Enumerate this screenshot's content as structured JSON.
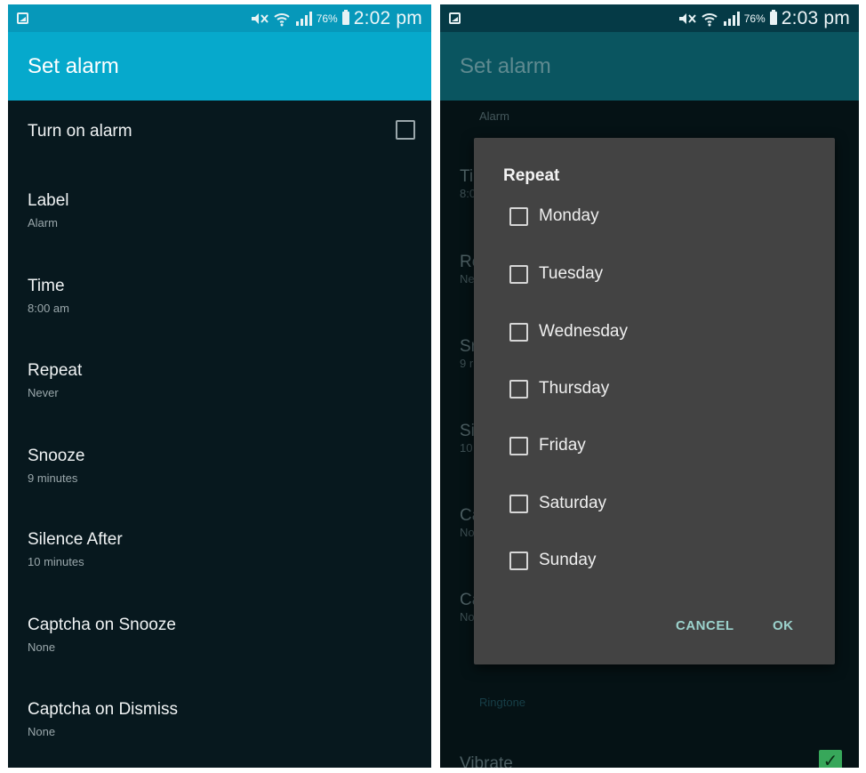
{
  "left": {
    "status": {
      "time": "2:02 pm",
      "battery": "76%"
    },
    "appbar_title": "Set alarm",
    "prefs": [
      {
        "title": "Turn on alarm",
        "subtitle": ""
      },
      {
        "title": "Label",
        "subtitle": "Alarm"
      },
      {
        "title": "Time",
        "subtitle": "8:00 am"
      },
      {
        "title": "Repeat",
        "subtitle": "Never"
      },
      {
        "title": "Snooze",
        "subtitle": "9 minutes"
      },
      {
        "title": "Silence After",
        "subtitle": "10 minutes"
      },
      {
        "title": "Captcha on Snooze",
        "subtitle": "None"
      },
      {
        "title": "Captcha on Dismiss",
        "subtitle": "None"
      }
    ]
  },
  "right": {
    "status": {
      "time": "2:03 pm",
      "battery": "76%"
    },
    "appbar_title": "Set alarm",
    "bg": {
      "section_alarm": "Alarm",
      "time_title": "Ti",
      "time_sub": "8:0",
      "repeat_title": "Re",
      "repeat_sub": "Ne",
      "snooze_title": "Sn",
      "snooze_sub": "9 r",
      "silence_title": "Si",
      "silence_sub": "10",
      "captcha1_title": "Ca",
      "captcha1_sub": "No",
      "captcha2_title": "Ca",
      "captcha2_sub": "No",
      "section_ringtone": "Ringtone",
      "vibrate": "Vibrate"
    },
    "dialog": {
      "title": "Repeat",
      "options": [
        "Monday",
        "Tuesday",
        "Wednesday",
        "Thursday",
        "Friday",
        "Saturday",
        "Sunday"
      ],
      "cancel": "CANCEL",
      "ok": "OK"
    }
  },
  "colors": {
    "accent": "#06a9cc",
    "check_green": "#37a75a",
    "dialog_button": "#9cd3cd"
  }
}
